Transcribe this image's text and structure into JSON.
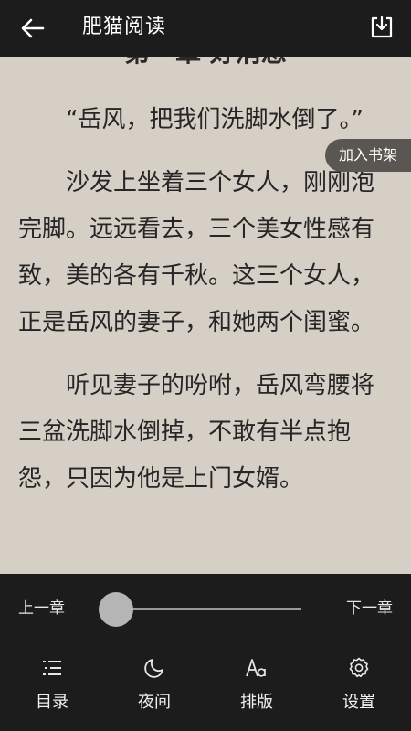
{
  "header": {
    "title": "肥猫阅读"
  },
  "reader": {
    "chapter_title": "第一章 好消息",
    "paragraphs": [
      "“岳风，把我们洗脚水倒了。”",
      "沙发上坐着三个女人，刚刚泡完脚。远远看去，三个美女性感有致，美的各有千秋。这三个女人，正是岳风的妻子，和她两个闺蜜。",
      "听见妻子的吩咐，岳风弯腰将三盆洗脚水倒掉，不敢有半点抱怨，只因为他是上门女婿。"
    ],
    "bookmark_label": "加入书架"
  },
  "progress": {
    "prev_label": "上一章",
    "next_label": "下一章",
    "value": 0
  },
  "nav": {
    "items": [
      {
        "label": "目录",
        "icon": "toc-icon"
      },
      {
        "label": "夜间",
        "icon": "night-mode-icon"
      },
      {
        "label": "排版",
        "icon": "typography-icon"
      },
      {
        "label": "设置",
        "icon": "settings-gear-icon"
      }
    ]
  },
  "colors": {
    "page_background": "#d6cfc6",
    "bars": "#1c1c1c",
    "bookmark_pill": "#5a5651"
  }
}
